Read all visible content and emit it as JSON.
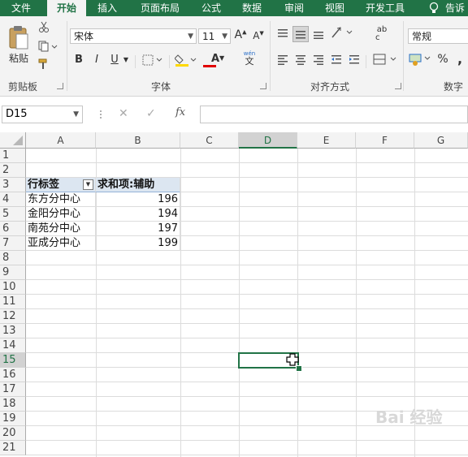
{
  "tabs": [
    "文件",
    "开始",
    "插入",
    "页面布局",
    "公式",
    "数据",
    "审阅",
    "视图",
    "开发工具",
    "告诉"
  ],
  "active_tab": "开始",
  "ribbon": {
    "clipboard": {
      "label": "剪贴板",
      "paste": "粘贴"
    },
    "font": {
      "label": "字体",
      "name": "宋体",
      "size": "11",
      "bold": "B",
      "italic": "I",
      "underline": "U",
      "grow": "A",
      "shrink": "A",
      "font_color_letter": "A",
      "phonetic": "wén",
      "phonetic_char": "文"
    },
    "alignment": {
      "label": "对齐方式",
      "wrap": "ab",
      "wrap2": "c"
    },
    "number": {
      "label": "数字",
      "format": "常规",
      "percent": "%",
      "comma": ","
    }
  },
  "formula_bar": {
    "name_box": "D15",
    "cancel": "✕",
    "enter": "✓",
    "fx": "fx"
  },
  "columns": [
    "A",
    "B",
    "C",
    "D",
    "E",
    "F",
    "G"
  ],
  "rows": [
    "1",
    "2",
    "3",
    "4",
    "5",
    "6",
    "7",
    "8",
    "9",
    "10",
    "11",
    "12",
    "13",
    "14",
    "15",
    "16",
    "17",
    "18",
    "19",
    "20",
    "21"
  ],
  "selected_cell": {
    "col": "D",
    "row": "15"
  },
  "pivot": {
    "header_row_label": "行标签",
    "header_value_label": "求和项:辅助",
    "rows": [
      {
        "label": "东方分中心",
        "value": "196"
      },
      {
        "label": "金阳分中心",
        "value": "194"
      },
      {
        "label": "南苑分中心",
        "value": "197"
      },
      {
        "label": "亚成分中心",
        "value": "199"
      }
    ]
  },
  "watermark": "Bai 经验"
}
